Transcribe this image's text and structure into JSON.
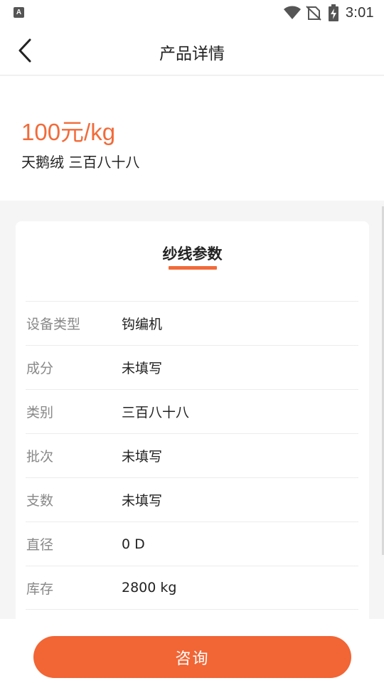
{
  "status_bar": {
    "app_icon_letter": "A",
    "time": "3:01",
    "icons": [
      "wifi-icon",
      "no-sim-icon",
      "battery-charging-icon"
    ]
  },
  "header": {
    "title": "产品详情",
    "back_icon": "chevron-left-icon"
  },
  "product": {
    "price": "100元/kg",
    "name": "天鹅绒 三百八十八"
  },
  "params": {
    "title": "纱线参数",
    "rows": [
      {
        "label": "设备类型",
        "value": "钩编机"
      },
      {
        "label": "成分",
        "value": "未填写"
      },
      {
        "label": "类别",
        "value": "三百八十八"
      },
      {
        "label": "批次",
        "value": "未填写"
      },
      {
        "label": "支数",
        "value": "未填写"
      },
      {
        "label": "直径",
        "value": "0 D"
      },
      {
        "label": "库存",
        "value": "2800 kg"
      }
    ]
  },
  "footer": {
    "consult_label": "咨询"
  },
  "colors": {
    "accent": "#f26b3a",
    "button": "#f26535",
    "background": "#f5f5f5"
  }
}
